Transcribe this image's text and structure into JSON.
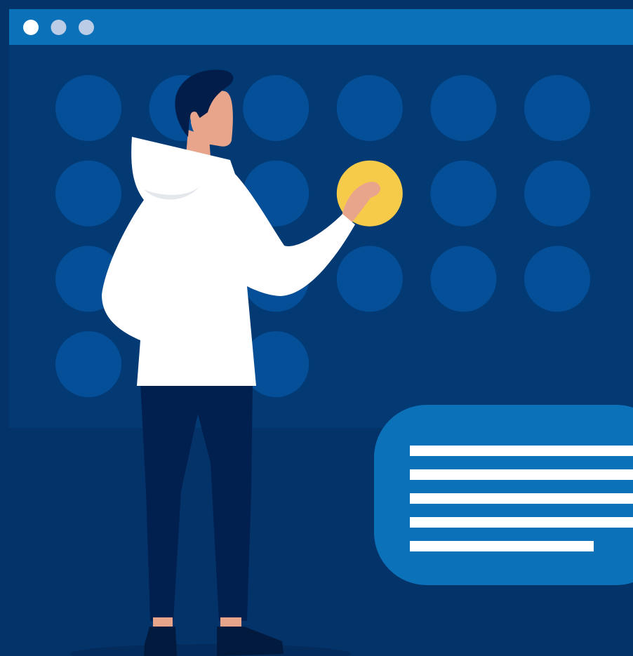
{
  "colors": {
    "background": "#04336A",
    "window_panel": "#033A74",
    "title_bar": "#0B72B9",
    "grid_circle": "#054F98",
    "active_circle": "#F6CB49",
    "message_card": "#0B72B9",
    "text_line": "#FFFFFF",
    "window_dot_primary": "#FFFFFF",
    "window_dot_secondary": "#BBCDE6",
    "skin": "#E9A58B",
    "hair": "#021D4A",
    "hoodie": "#FFFFFF",
    "pants": "#02204F",
    "shoes": "#021A3D"
  },
  "window": {
    "controls": [
      {
        "name": "window-dot-1"
      },
      {
        "name": "window-dot-2"
      },
      {
        "name": "window-dot-3"
      }
    ]
  },
  "grid": {
    "rows": [
      {
        "cells": [
          false,
          false,
          false,
          false,
          false,
          false
        ]
      },
      {
        "cells": [
          false,
          false,
          false,
          true,
          false,
          false
        ]
      },
      {
        "cells": [
          false,
          false,
          false,
          false,
          false,
          false
        ]
      },
      {
        "cells": [
          false,
          false,
          false
        ]
      }
    ]
  },
  "message_card": {
    "line_count": 5
  },
  "icons": [
    "person-illustration",
    "window-dot",
    "grid-circle",
    "text-line"
  ]
}
